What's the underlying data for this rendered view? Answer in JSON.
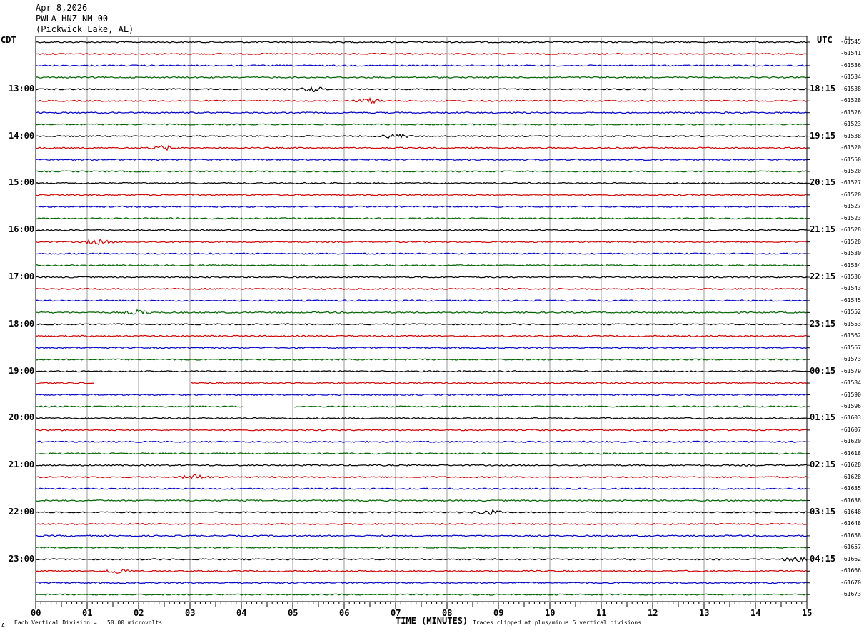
{
  "header": {
    "date": "Apr 8,2026",
    "station": "PWLA HNZ NM 00",
    "location": "(Pickwick Lake, AL)"
  },
  "left_axis_title": "CDT",
  "right_axis_title": "UTC",
  "dc_title": "DC",
  "footer": {
    "scale": "Each Vertical Division =   50.00 microvolts",
    "clip": "Traces clipped at plus/minus 5 vertical divisions",
    "corner": "A"
  },
  "chart_data": {
    "type": "line",
    "title": "",
    "xlabel": "TIME (MINUTES)",
    "xlim": [
      0,
      15
    ],
    "x_ticks": [
      "00",
      "01",
      "02",
      "03",
      "04",
      "05",
      "06",
      "07",
      "08",
      "09",
      "10",
      "11",
      "12",
      "13",
      "14",
      "15"
    ],
    "trace_colors": [
      "#000000",
      "#d00000",
      "#0000c8",
      "#006400"
    ],
    "left_hour_labels": [
      "13:00",
      "14:00",
      "15:00",
      "16:00",
      "17:00",
      "18:00",
      "19:00",
      "20:00",
      "21:00",
      "22:00",
      "23:00"
    ],
    "right_hour_labels": [
      "18:15",
      "19:15",
      "20:15",
      "21:15",
      "22:15",
      "23:15",
      "00:15",
      "01:15",
      "02:15",
      "03:15",
      "04:15"
    ],
    "dc_offsets": [
      "-61545",
      "-61541",
      "-61536",
      "-61534",
      "-61538",
      "-61528",
      "-61526",
      "-61523",
      "-61538",
      "-61520",
      "-61550",
      "-61520",
      "-61527",
      "-61520",
      "-61527",
      "-61523",
      "-61528",
      "-61528",
      "-61530",
      "-61534",
      "-61536",
      "-61543",
      "-61545",
      "-61552",
      "-61553",
      "-61562",
      "-61567",
      "-61573",
      "-61579",
      "-61584",
      "-61590",
      "-61596",
      "-61603",
      "-61607",
      "-61620",
      "-61618",
      "-61628",
      "-61628",
      "-61635",
      "-61638",
      "-61648",
      "-61648",
      "-61658",
      "-61657",
      "-61662",
      "-61666",
      "-61670",
      "-61673"
    ],
    "gaps": [
      {
        "row": 29,
        "from_min": 1.15,
        "to_min": 3.0
      },
      {
        "row": 31,
        "from_min": 4.05,
        "to_min": 5.0
      }
    ],
    "event_bursts": [
      {
        "row": 4,
        "at_min": 5.4
      },
      {
        "row": 5,
        "at_min": 6.5
      },
      {
        "row": 8,
        "at_min": 7.0
      },
      {
        "row": 9,
        "at_min": 2.5
      },
      {
        "row": 17,
        "at_min": 1.2
      },
      {
        "row": 23,
        "at_min": 2.0
      },
      {
        "row": 37,
        "at_min": 3.1
      },
      {
        "row": 40,
        "at_min": 8.8
      },
      {
        "row": 45,
        "at_min": 1.6
      },
      {
        "row": 44,
        "at_min": 14.8
      }
    ]
  }
}
